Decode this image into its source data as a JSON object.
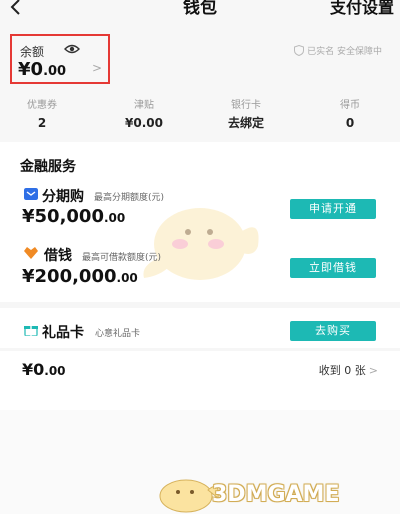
{
  "nav": {
    "title": "钱包",
    "right_label": "支付设置"
  },
  "balance": {
    "label": "余额",
    "currency": "¥",
    "amount_int": "0",
    "amount_dec": ".00",
    "arrow": ">"
  },
  "safety": {
    "text": "已实名 安全保障中"
  },
  "stats": [
    {
      "label": "优惠券",
      "value": "2"
    },
    {
      "label": "津贴",
      "value": "¥0.00"
    },
    {
      "label": "银行卡",
      "value": "去绑定"
    },
    {
      "label": "得币",
      "value": "0"
    }
  ],
  "finance": {
    "title": "金融服务"
  },
  "installment": {
    "name": "分期购",
    "note": "最高分期额度(元)",
    "amount_int": "¥50,000",
    "amount_dec": ".00",
    "button": "申请开通",
    "icon_color": "#2f6fe6"
  },
  "loan": {
    "name": "借钱",
    "note": "最高可借款额度(元)",
    "amount_int": "¥200,000",
    "amount_dec": ".00",
    "button": "立即借钱",
    "icon_color": "#f08a24"
  },
  "gift": {
    "name": "礼品卡",
    "note": "心意礼品卡",
    "button": "去购买",
    "amount_int": "¥0",
    "amount_dec": ".00",
    "received": "收到 0 张",
    "chevron": ">"
  },
  "watermark": {
    "text": "3DMGAME"
  },
  "colors": {
    "accent": "#1db9b4",
    "highlight_border": "#e53935"
  }
}
